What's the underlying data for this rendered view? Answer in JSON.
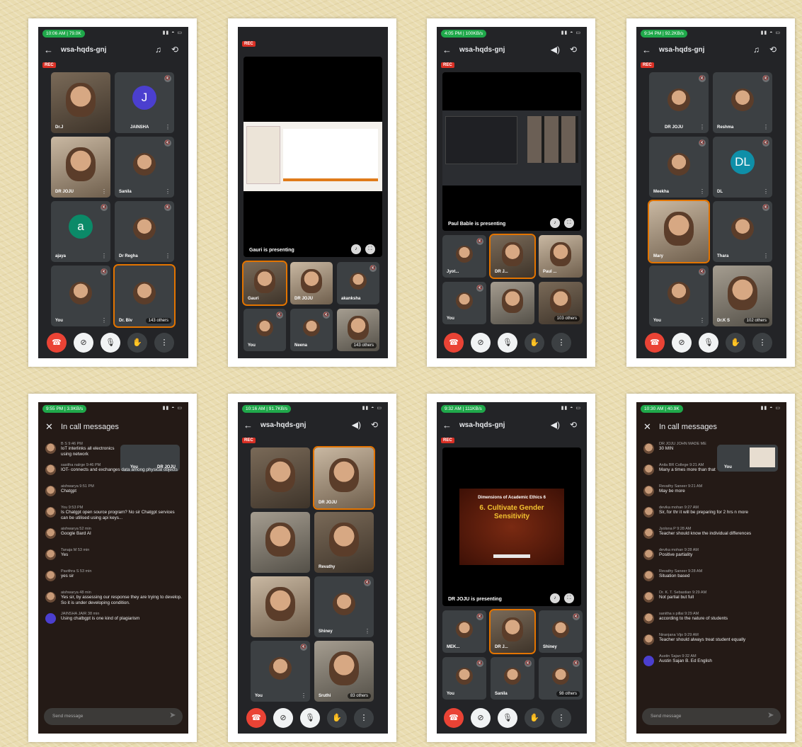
{
  "meeting_code": "wsa-hqds-gnj",
  "rec_label": "REC",
  "phones": [
    {
      "status_pill": "10:06 AM | 79.0K",
      "tiles": [
        {
          "name": "DR",
          "label": "Dr.J"
        },
        {
          "name": "JAINSHA",
          "avatar": "J",
          "color": "#4b3fcf"
        },
        {
          "name": "DR JOJU"
        },
        {
          "name": "Sanila"
        },
        {
          "name": "ajaya",
          "avatar": "a",
          "color": "#0b8a68"
        },
        {
          "name": "Dr Regha"
        },
        {
          "name": "You"
        },
        {
          "name": "Dr. Biv",
          "others": "143 others"
        }
      ]
    },
    {
      "presenting": "Gauri is presenting",
      "tiles": [
        {
          "name": "Gauri"
        },
        {
          "name": "DR JOJU"
        },
        {
          "name": "akanksha"
        },
        {
          "name": "You"
        },
        {
          "name": "Neena"
        },
        {
          "name": "",
          "others": "143 others"
        }
      ]
    },
    {
      "status_pill": "4:05 PM | 100KB/s",
      "presenting": "Paul Bable is presenting",
      "tiles": [
        {
          "name": "Jyot..."
        },
        {
          "name": "DR J..."
        },
        {
          "name": "Paul ..."
        },
        {
          "name": "You"
        },
        {
          "name": ""
        },
        {
          "name": "",
          "others": "103 others"
        }
      ]
    },
    {
      "status_pill": "9:34 PM | 92.2KB/s",
      "tiles": [
        {
          "name": "DR JOJU"
        },
        {
          "name": "Reshma"
        },
        {
          "name": "Meekha"
        },
        {
          "name": "DL",
          "avatar": "DL",
          "color": "#0f8fa8"
        },
        {
          "name": "Mary"
        },
        {
          "name": "Thara"
        },
        {
          "name": "You"
        },
        {
          "name": "Dr.K S",
          "others": "102 others"
        }
      ]
    }
  ],
  "messages_left": {
    "status_pill": "9:55 PM | 3.9KB/s",
    "title": "In call messages",
    "items": [
      {
        "meta": "B S   9:46 PM",
        "text": "IoT interlinks all electronics using network"
      },
      {
        "meta": "sasitha nalrge   9:46 PM",
        "text": "IOT- connects and exchanges data among physical objects"
      },
      {
        "meta": "aishwarya   9:51 PM",
        "text": "Chatgpt"
      },
      {
        "meta": "You   9:53 PM",
        "text": "Is Chatgpt open source program? No sir Chatgpt services can be utilised using api keys..."
      },
      {
        "meta": "aishwarya   52 min",
        "text": "Google Bard AI"
      },
      {
        "meta": "Tanaja M   53 min",
        "text": "Yes"
      },
      {
        "meta": "Pavithra S   53 min",
        "text": "yes sir"
      },
      {
        "meta": "aishwarya   48 min",
        "text": "Yes sir, by assessing our response they are trying to develop. So it is under developing condition."
      },
      {
        "meta": "JAINSHA JAIR   38 min",
        "text": "Using chatbgpt is one kind of plagiarism"
      }
    ],
    "pip_labels": [
      "You",
      "DR JOJU"
    ],
    "input_placeholder": "Send message"
  },
  "phone6": {
    "status_pill": "10:16 AM | 91.7KB/s",
    "tiles": [
      {
        "name": ""
      },
      {
        "name": "DR JOJU"
      },
      {
        "name": ""
      },
      {
        "name": "Revathy"
      },
      {
        "name": ""
      },
      {
        "name": "Shiney"
      },
      {
        "name": "You"
      },
      {
        "name": "Sruthi",
        "others": "83 others"
      }
    ]
  },
  "phone7": {
    "status_pill": "9:32 AM | 111KB/s",
    "presenting": "DR JOJU is presenting",
    "slide_title": "Dimensions of Academic Ethics 6",
    "slide_heading": "6. Cultivate Gender Sensitivity",
    "tiles": [
      {
        "name": "MEK..."
      },
      {
        "name": "DR J..."
      },
      {
        "name": "Shiney"
      },
      {
        "name": "You"
      },
      {
        "name": "Sanila"
      },
      {
        "name": "",
        "others": "98 others"
      }
    ]
  },
  "messages_right": {
    "status_pill": "10:30 AM | 40.9K",
    "title": "In call messages",
    "items": [
      {
        "meta": "DR JOJU JOHN MADE ME",
        "text": "30 MIN"
      },
      {
        "meta": "Anila BR College   9:21 AM",
        "text": "Many a times more than that"
      },
      {
        "meta": "Revathy Saneer   9:21 AM",
        "text": "May be more"
      },
      {
        "meta": "devika mohan   9:27 AM",
        "text": "Sir, for thr it will be preparing for 2 hrs n more"
      },
      {
        "meta": "Jyolsna P   9:28 AM",
        "text": "Teacher should know the individual differences"
      },
      {
        "meta": "devika mohan   9:28 AM",
        "text": "Positive partiality"
      },
      {
        "meta": "Revathy Saneer   9:28 AM",
        "text": "Situation based"
      },
      {
        "meta": "Dr. K. T. Sebastian   9:29 AM",
        "text": "Not partial but full"
      },
      {
        "meta": "sanitha s pillai   9:29 AM",
        "text": "according to the nature of students"
      },
      {
        "meta": "Niranjana Vijo   9:29 AM",
        "text": "Teacher should always treat student equally"
      },
      {
        "meta": "Austin Sajan   9:32 AM",
        "text": "Austin Sajan B. Ed English"
      }
    ],
    "pip_labels": [
      "You"
    ],
    "input_placeholder": "Send message"
  },
  "icons": {
    "back": "arrow-left-icon",
    "headphones": "headphones-icon",
    "speaker": "speaker-icon",
    "switch_camera": "switch-camera-icon",
    "end_call": "end-call-icon",
    "camera_off": "camera-off-icon",
    "mic_off": "mic-off-icon",
    "hand": "raise-hand-icon",
    "more": "more-icon"
  },
  "colors": {
    "end_call": "#ea4335",
    "rec": "#d93025",
    "pill": "#1fa84a",
    "active_speaker": "#e37400"
  }
}
